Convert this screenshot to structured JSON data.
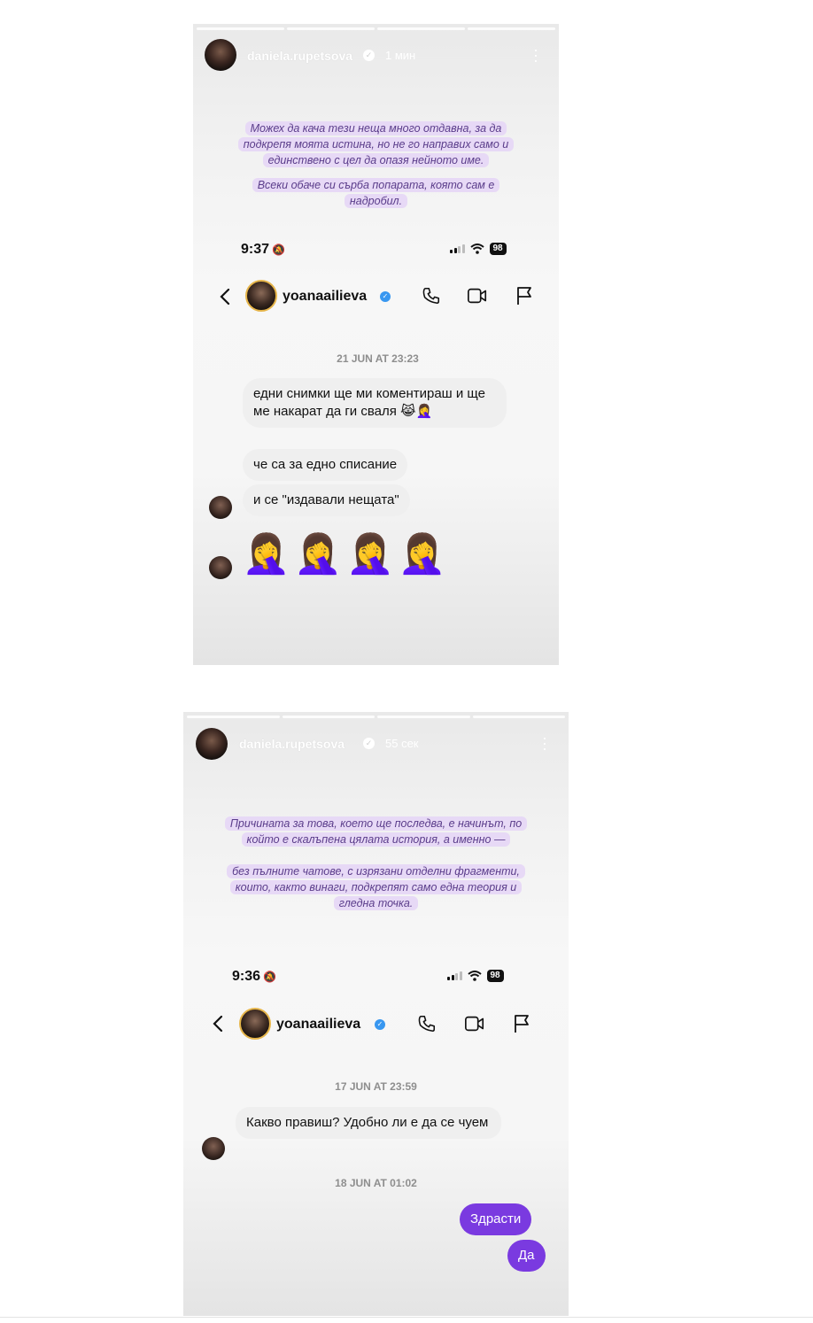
{
  "stories": [
    {
      "user": "daniela.rupetsova",
      "time": "1 мин",
      "captions": [
        "Можех да кача тези неща много отдавна, за да подкрепя моята истина, но не го направих само и единствено с цел да опазя нейното име.",
        "Всеки обаче си сърба попарата, която сам е надробил."
      ],
      "screenshot": {
        "status_time": "9:37",
        "battery": "98",
        "dm_user": "yoanaailieva",
        "timestamp": "21 JUN AT 23:23",
        "messages": [
          "едни снимки ще ми коментираш и ще ме накарат да ги сваля 😹🤦‍♀️",
          "че са за едно списание",
          "и се \"издавали нещата\""
        ],
        "emoji_row": "🤦‍♀️🤦‍♀️🤦‍♀️🤦‍♀️"
      }
    },
    {
      "user": "daniela.rupetsova",
      "time": "55 сек",
      "captions": [
        "Причината за това, което ще последва, е начинът, по който е скалъпена цялата история, а именно —",
        "без пълните чатове, с изрязани отделни фрагменти, които, както винаги, подкрепят само една теория и гледна точка."
      ],
      "screenshot": {
        "status_time": "9:36",
        "battery": "98",
        "dm_user": "yoanaailieva",
        "timestamp1": "17 JUN AT 23:59",
        "incoming": "Какво правиш? Удобно ли е да се чуем",
        "timestamp2": "18 JUN AT 01:02",
        "outgoing": [
          "Здрасти",
          "Да"
        ]
      }
    }
  ],
  "icons": {
    "verified": "verified-check-icon",
    "back": "chevron-left-icon",
    "phone": "phone-icon",
    "video": "video-camera-icon",
    "flag": "flag-icon",
    "more": "more-vertical-icon",
    "silent": "bell-slash-icon",
    "signal": "signal-icon",
    "wifi": "wifi-icon",
    "battery": "battery-icon"
  },
  "colors": {
    "caption_bg": "#e7d9f6",
    "caption_text": "#5a3c8a",
    "outgoing_bubble": "#7a3ae0",
    "incoming_bubble": "#efefef",
    "verified_blue": "#3897f0"
  }
}
